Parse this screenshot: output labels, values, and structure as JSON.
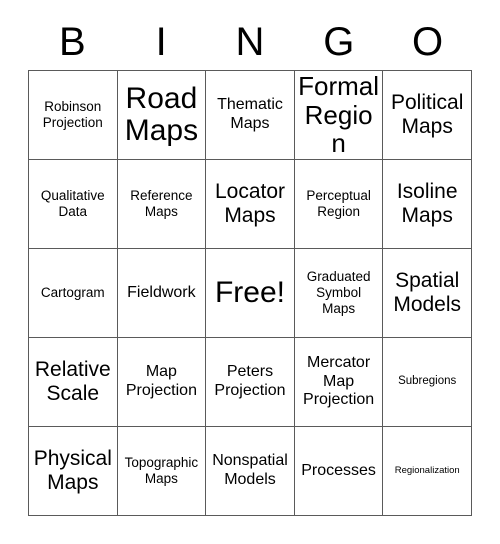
{
  "header": {
    "letters": [
      "B",
      "I",
      "N",
      "G",
      "O"
    ]
  },
  "grid": {
    "rows": 5,
    "columns": 5,
    "border_color": "#5a5a5a",
    "background": "#ffffff",
    "text_color": "#000000",
    "cells": [
      {
        "text": "Robinson Projection",
        "size": "s"
      },
      {
        "text": "Road Maps",
        "size": "xxl"
      },
      {
        "text": "Thematic Maps",
        "size": "m"
      },
      {
        "text": "Formal Region",
        "size": "xl"
      },
      {
        "text": "Political Maps",
        "size": "l"
      },
      {
        "text": "Qualitative Data",
        "size": "s"
      },
      {
        "text": "Reference Maps",
        "size": "s"
      },
      {
        "text": "Locator Maps",
        "size": "l"
      },
      {
        "text": "Perceptual Region",
        "size": "s"
      },
      {
        "text": "Isoline Maps",
        "size": "l"
      },
      {
        "text": "Cartogram",
        "size": "s"
      },
      {
        "text": "Fieldwork",
        "size": "m"
      },
      {
        "text": "Free!",
        "size": "xxl"
      },
      {
        "text": "Graduated Symbol Maps",
        "size": "s"
      },
      {
        "text": "Spatial Models",
        "size": "l"
      },
      {
        "text": "Relative Scale",
        "size": "l"
      },
      {
        "text": "Map Projection",
        "size": "m"
      },
      {
        "text": "Peters Projection",
        "size": "m"
      },
      {
        "text": "Mercator Map Projection",
        "size": "m"
      },
      {
        "text": "Subregions",
        "size": "xs"
      },
      {
        "text": "Physical Maps",
        "size": "l"
      },
      {
        "text": "Topographic Maps",
        "size": "s"
      },
      {
        "text": "Nonspatial Models",
        "size": "m"
      },
      {
        "text": "Processes",
        "size": "m"
      },
      {
        "text": "Regionalization",
        "size": "xxs"
      }
    ]
  }
}
